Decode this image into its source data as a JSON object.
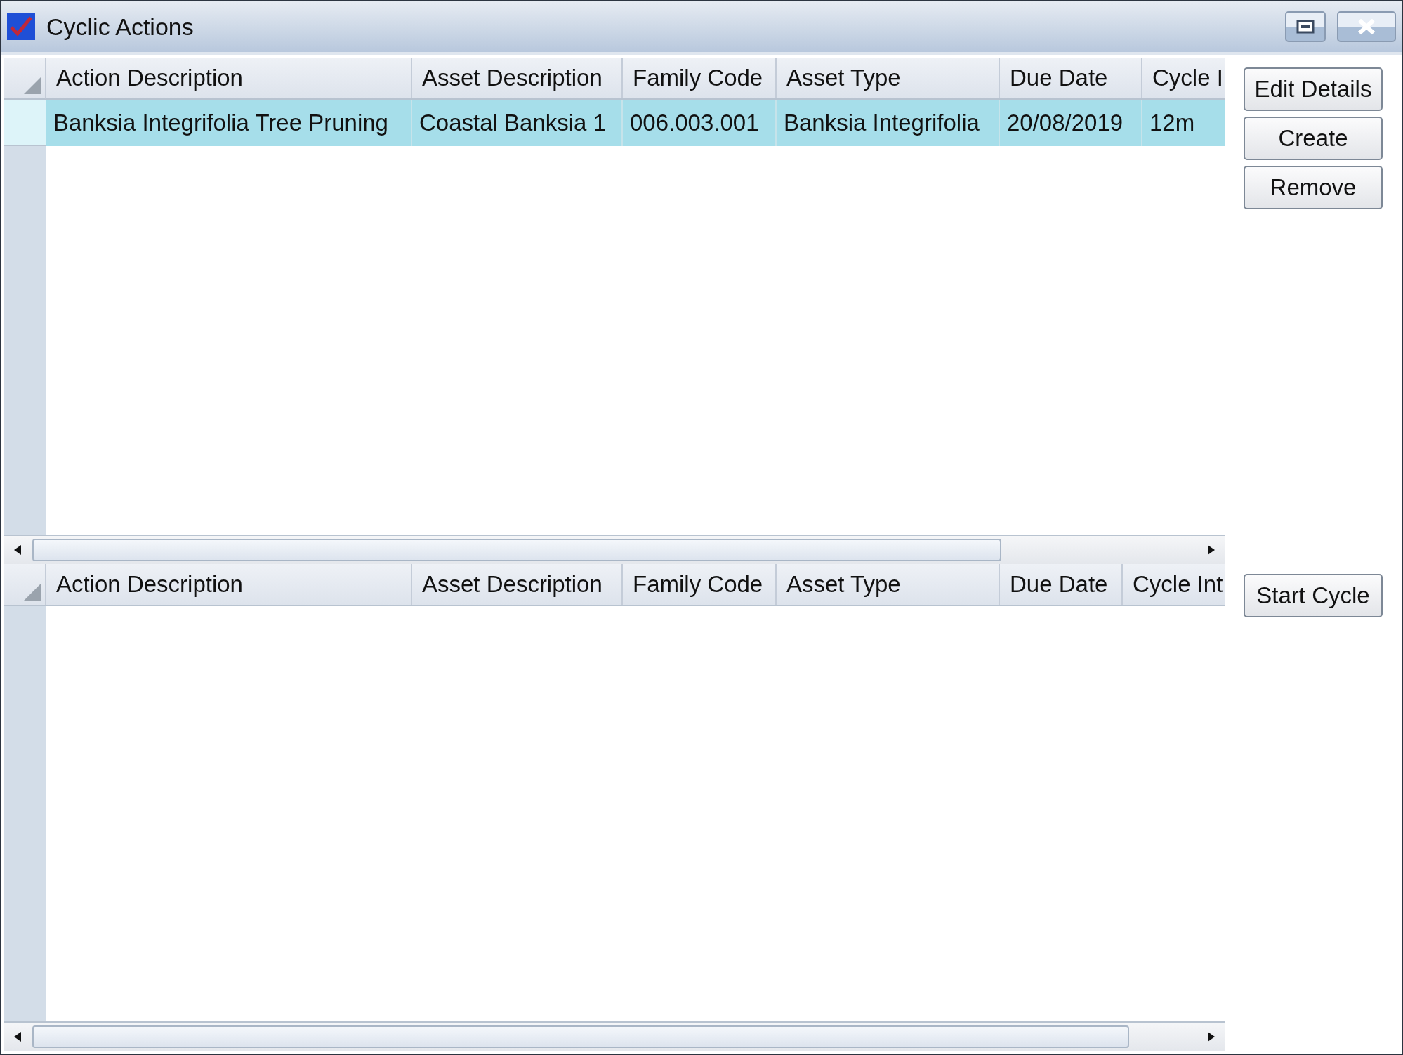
{
  "window": {
    "title": "Cyclic Actions",
    "controls": [
      {
        "kind": "restore"
      },
      {
        "kind": "close"
      }
    ]
  },
  "actions_table": {
    "columns": [
      "Action Description",
      "Asset Description",
      "Family Code",
      "Asset Type",
      "Due Date",
      "Cycle I"
    ],
    "rows": [
      {
        "selected": true,
        "cells": [
          "Banksia Integrifolia Tree Pruning",
          "Coastal Banksia 1",
          "006.003.001",
          "Banksia Integrifolia",
          "20/08/2019",
          "12m"
        ]
      }
    ]
  },
  "action_buttons": [
    "Edit Details",
    "Create",
    "Remove"
  ],
  "cycle_table": {
    "columns": [
      "Action Description",
      "Asset Description",
      "Family Code",
      "Asset Type",
      "Due Date",
      "Cycle Int"
    ]
  },
  "cycle_buttons": [
    "Start Cycle"
  ]
}
